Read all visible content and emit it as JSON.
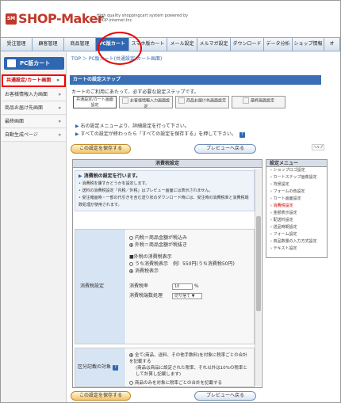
{
  "brand": {
    "logo_mark": "SM",
    "logo_text": "SHOP-Maker",
    "tagline": "High quality shoppingcart system powered by SHOP-internet.Inc"
  },
  "nav": [
    "受注管理",
    "顧客管理",
    "商品管理",
    "PC版カート",
    "スマホ版カート",
    "メール設定",
    "メルマガ設定",
    "ダウンロード",
    "データ分析",
    "ショップ情報",
    "オ"
  ],
  "sidebar": {
    "title": "PC版カート",
    "items": [
      "共通設定/カート画面",
      "お客様情報入力画面",
      "商品お届け先画面",
      "最終画面",
      "自動生成ページ"
    ]
  },
  "breadcrumb": "TOP ＞ PC版カート(共通設定/カート画面)",
  "main": {
    "heading": "カートの設定ステップ",
    "note": "カートのご利用にあたって、必ず必要な設定ステップです。",
    "steps": [
      "共通設定/カート画面設定",
      "お客様情報入力画面設定",
      "商品お届け先画面設定",
      "最終画面設定"
    ],
    "info": [
      "右の設定メニューより、詳細設定を行って下さい。",
      "すべての設定が終わったら「すべての設定を保存する」を押して下さい。"
    ],
    "save_all": "この設定を保存する",
    "preview_back": "プレビューへ戻る",
    "help": "ヘルプ"
  },
  "panel": {
    "title": "消費税設定",
    "lead": "消費税の設定を行います。",
    "desc": [
      "消費税を課すかどうかを設定します。",
      "送料の消費税設定「内税／外税」はプレビュー画面には表示されません。",
      "受注確画時・一部の代引きを含む送り状のダウンロード時には、受注時の消費税率と消費税端数処理が使用されます。"
    ],
    "row1_label": "消費税設定",
    "opt_inclusive": "内税＝商品金額が税込み",
    "opt_exclusive": "外税＝商品金額が税抜き",
    "display_title": "■外税の消費税表示",
    "display_opt1": "うち消費税表示",
    "display_example": "例）550円(うち消費税50円)",
    "display_opt2": "消費税表示",
    "rate_label": "消費税率",
    "rate_value": "10",
    "rate_unit": "%",
    "rounding_label": "消費税端数処理",
    "rounding_value": "切り捨て",
    "row2_label": "区分記載の対象",
    "row2_opt1": "全て(商品、送料、その他手数料)を対象に税率ごとの合計を記載する",
    "row2_opt1_note": "(商品は商品に設定された税率、それ以外は10%の税率として計算し記載します)",
    "row2_opt2": "商品のみを対象に税率ごとの合計を記載する"
  },
  "menu": {
    "title": "設定メニュー",
    "items": [
      "ショップロゴ設定",
      "カートステップ画像設定",
      "背景設定",
      "フォームの色設定",
      "カート画面設定",
      "消費税設定",
      "金額表示設定",
      "配送料設定",
      "送品時期設定",
      "フォーム設定",
      "商品数量の入力方式設定",
      "テキスト設定"
    ]
  }
}
